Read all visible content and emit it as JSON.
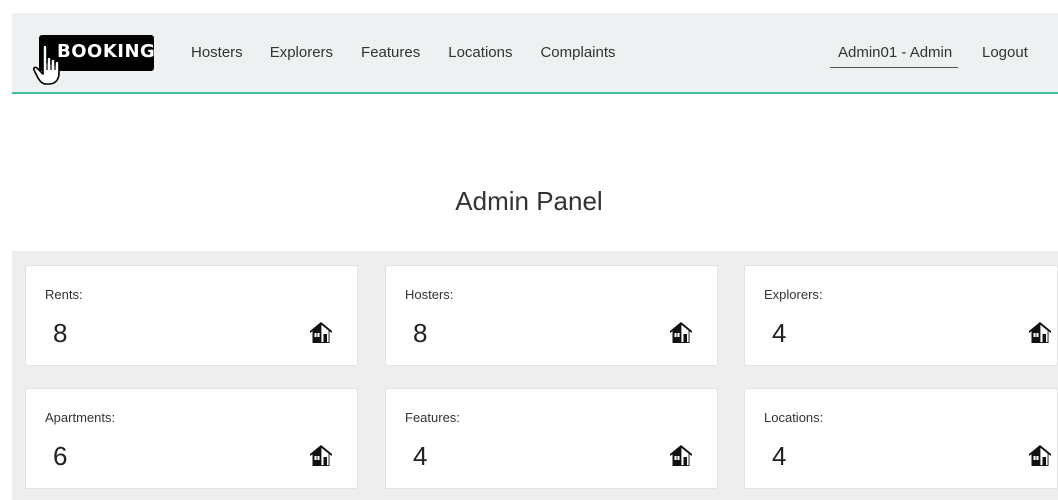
{
  "brand": {
    "name": "BOOKING"
  },
  "nav": {
    "links": [
      "Hosters",
      "Explorers",
      "Features",
      "Locations",
      "Complaints"
    ],
    "user": "Admin01 - Admin",
    "logout": "Logout"
  },
  "page": {
    "title": "Admin Panel"
  },
  "cards": [
    {
      "label": "Rents:",
      "value": "8",
      "icon": "house-icon"
    },
    {
      "label": "Hosters:",
      "value": "8",
      "icon": "house-icon"
    },
    {
      "label": "Explorers:",
      "value": "4",
      "icon": "house-icon"
    },
    {
      "label": "Apartments:",
      "value": "6",
      "icon": "house-icon"
    },
    {
      "label": "Features:",
      "value": "4",
      "icon": "house-icon"
    },
    {
      "label": "Locations:",
      "value": "4",
      "icon": "house-icon"
    }
  ],
  "colors": {
    "accent": "#3fbf9b",
    "navbar_bg": "#eef1f2",
    "cards_bg": "#eeeeee"
  }
}
